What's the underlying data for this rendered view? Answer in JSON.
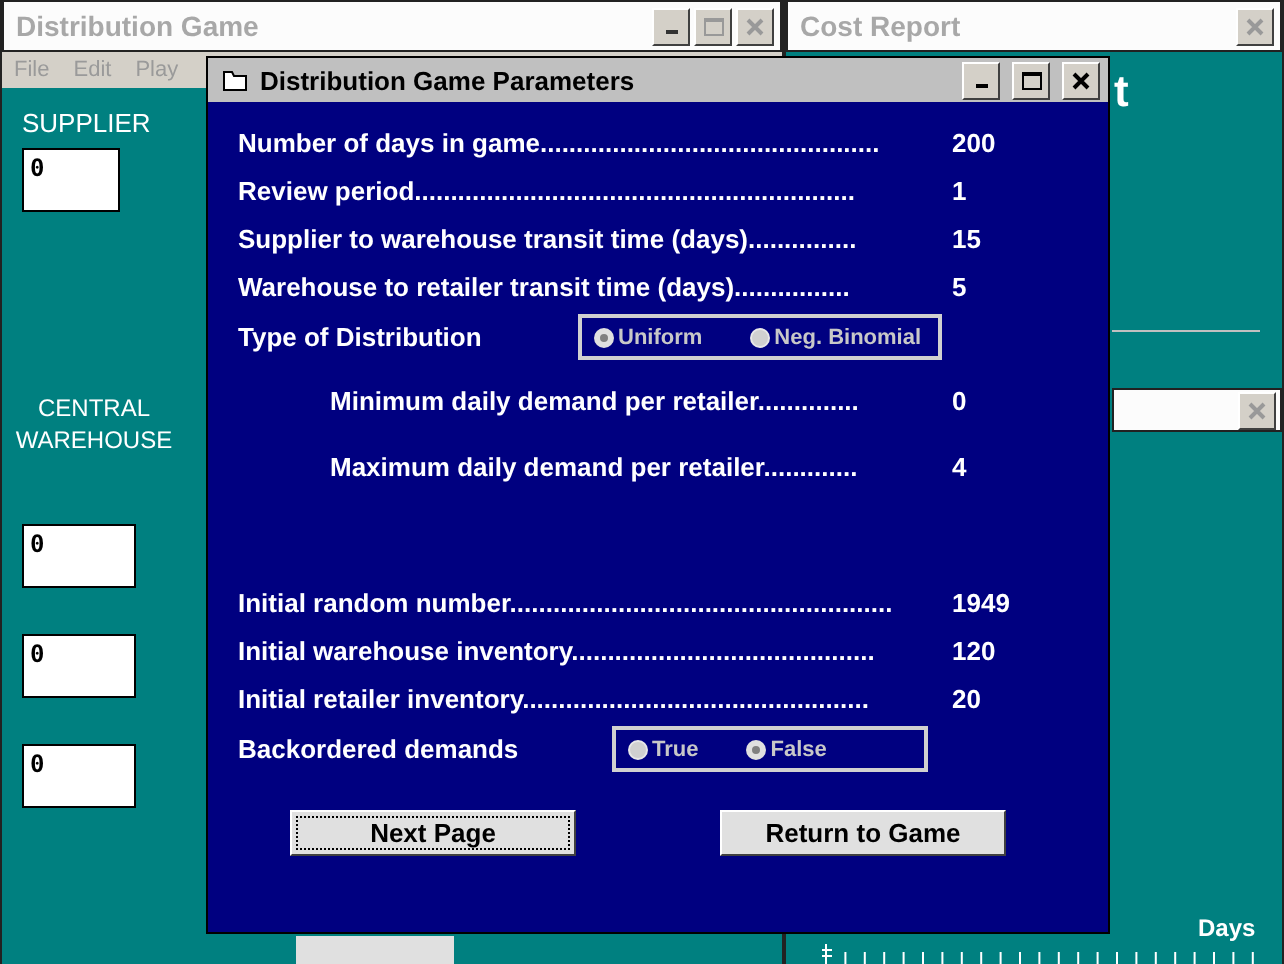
{
  "main_window": {
    "title": "Distribution Game",
    "menu": [
      "File",
      "Edit",
      "Play"
    ],
    "supplier_label": "SUPPLIER",
    "supplier_value": "0",
    "warehouse_label": "CENTRAL WAREHOUSE",
    "warehouse_values": [
      "0",
      "0",
      "0"
    ]
  },
  "cost_window": {
    "title": "Cost Report",
    "heading_visible": "t",
    "axis_label": "Days"
  },
  "dialog": {
    "title": "Distribution Game Parameters",
    "parameters": [
      {
        "kind": "param",
        "label": "Number of days in game...............................................",
        "value": "200"
      },
      {
        "kind": "param",
        "label": "Review period.............................................................",
        "value": "1"
      },
      {
        "kind": "param",
        "label": "Supplier to warehouse transit time (days)...............",
        "value": "15"
      },
      {
        "kind": "param",
        "label": "Warehouse to retailer transit time (days)................",
        "value": "5"
      },
      {
        "kind": "choice",
        "label": "Type of Distribution",
        "options": [
          {
            "label": "Uniform",
            "selected": true
          },
          {
            "label": "Neg. Binomial",
            "selected": false
          }
        ]
      },
      {
        "kind": "subparam",
        "label": "Minimum daily demand per retailer..............",
        "value": "0"
      },
      {
        "kind": "subparam",
        "label": "Maximum daily demand per retailer.............",
        "value": "4"
      }
    ],
    "initial_settings": [
      {
        "kind": "param",
        "label": "Initial random number.....................................................",
        "value": "1949"
      },
      {
        "kind": "param",
        "label": "Initial warehouse inventory..........................................",
        "value": "120"
      },
      {
        "kind": "param",
        "label": "Initial retailer inventory................................................",
        "value": "20"
      },
      {
        "kind": "choice",
        "label": "Backordered demands",
        "options": [
          {
            "label": "True",
            "selected": false
          },
          {
            "label": "False",
            "selected": true
          }
        ]
      }
    ],
    "buttons": [
      {
        "label": "Next Page",
        "focused": true
      },
      {
        "label": "Return to Game",
        "focused": false
      }
    ]
  }
}
